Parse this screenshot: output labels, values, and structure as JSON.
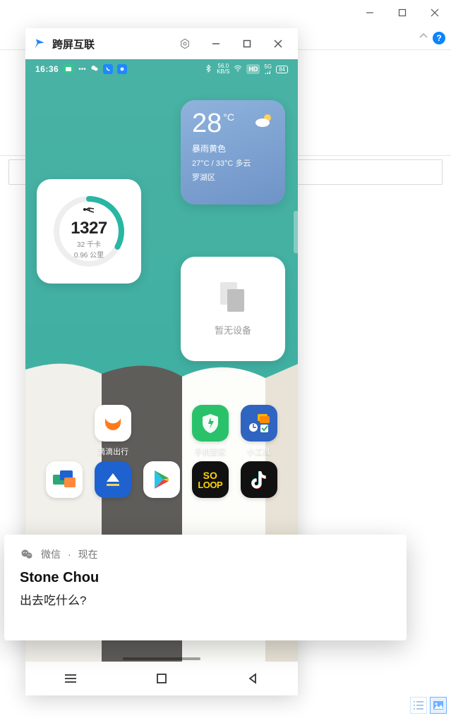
{
  "outer_window": {
    "min": "minimize",
    "max": "maximize",
    "close": "close"
  },
  "helper": {
    "chevron": "chevron-up",
    "help": "?"
  },
  "app": {
    "title": "跨屏互联",
    "settings": "settings",
    "min": "minimize",
    "max": "maximize",
    "close": "close"
  },
  "status": {
    "time": "16:36",
    "left_badge": "record",
    "wechat_icon": "wechat",
    "blue_badge_1": "call",
    "blue_badge_2": "app",
    "bt": "bluetooth",
    "net_speed_top": "56.0",
    "net_speed_bot": "KB/S",
    "wifi": "wifi",
    "hd": "HD",
    "five_g": "5G",
    "signal": "signal",
    "battery": "84"
  },
  "weather": {
    "temp": "28",
    "deg": "°C",
    "alert": "暴雨黄色",
    "range_cond": "27°C / 33°C  多云",
    "district": "罗湖区"
  },
  "steps": {
    "count": "1327",
    "cal": "32 千卡",
    "dist": "0.96 公里",
    "progress_pct": 33
  },
  "device_widget": {
    "label": "暂无设备"
  },
  "apps": {
    "r1c2_icon": "didi",
    "r1c2_name": "滴滴出行",
    "r1c4_icon": "shield",
    "r1c4_name": "手机管家",
    "r1c5_icon": "widgets",
    "r1c5_name": "小工具",
    "r2c1_icon": "tiles",
    "r2c2_icon": "up-arrow",
    "r2c3_icon": "play-store",
    "r2c4_icon": "soloop",
    "r2c4_label": "LOOP",
    "r2c4_label_top": "SO",
    "r2c5_icon": "douyin"
  },
  "nav": {
    "recents": "recents",
    "home": "home",
    "back": "back"
  },
  "notif": {
    "app_icon": "wechat",
    "app_name": "微信",
    "sep": "·",
    "time": "现在",
    "sender": "Stone Chou",
    "message": "出去吃什么?"
  },
  "view_toggles": {
    "list": "list-view",
    "thumb": "thumb-view"
  },
  "colors": {
    "teal": "#3fb0a2",
    "weather1": "#8fb3dc",
    "weather2": "#6e93c7",
    "ring": "#29b6a4",
    "blue": "#1e88ff"
  }
}
